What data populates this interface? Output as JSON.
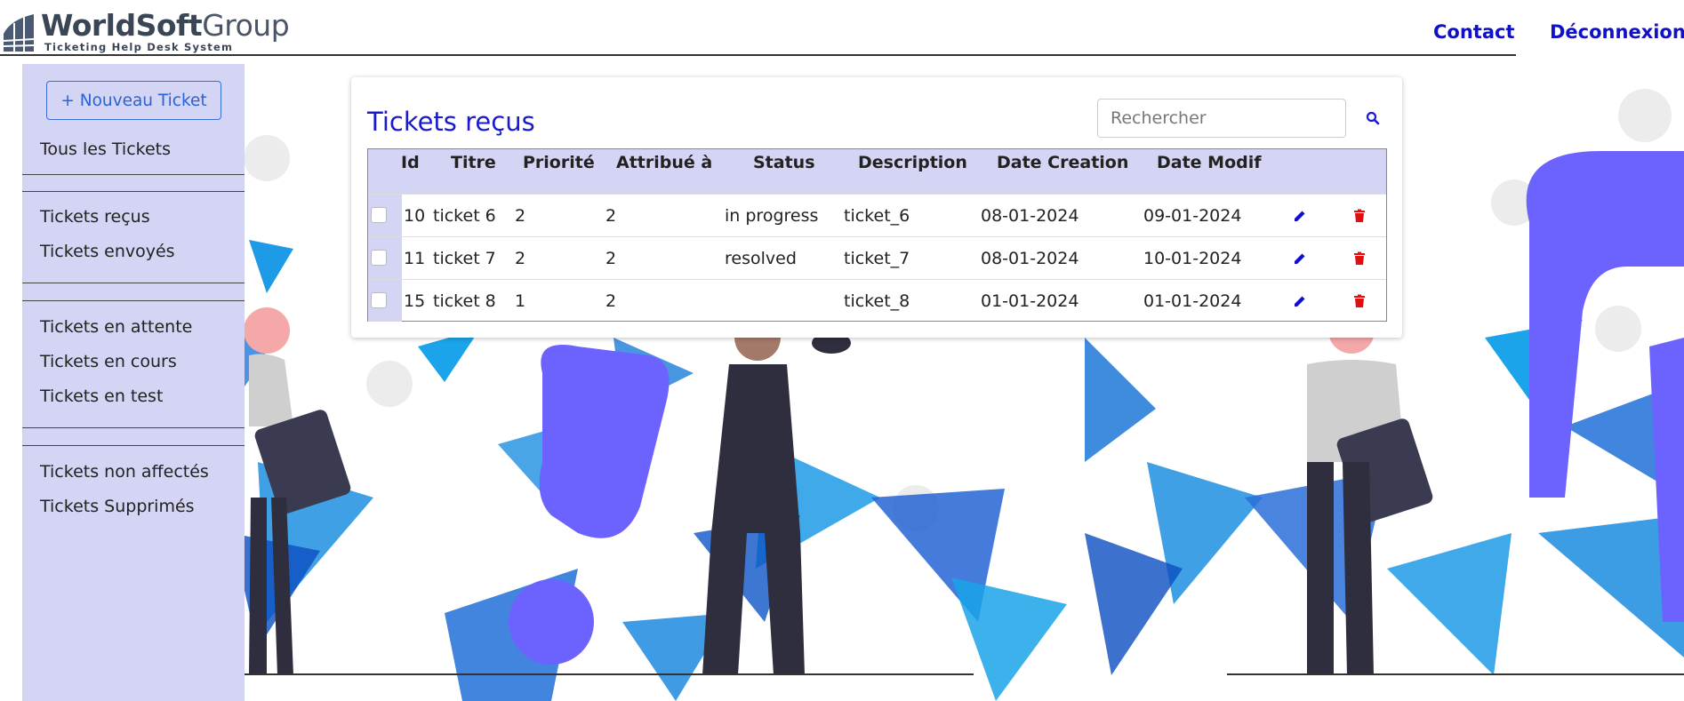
{
  "header": {
    "logo_brand_bold": "WorldSoft",
    "logo_brand_light": "Group",
    "logo_tagline": "Ticketing Help Desk System",
    "nav": {
      "contact_label": "Contact",
      "logout_label": "Déconnexion"
    }
  },
  "sidebar": {
    "new_ticket_label": "+ Nouveau Ticket",
    "items": [
      {
        "label": "Tous les Tickets"
      },
      {
        "label": "Tickets reçus"
      },
      {
        "label": "Tickets envoyés"
      },
      {
        "label": "Tickets en attente"
      },
      {
        "label": "Tickets en cours"
      },
      {
        "label": "Tickets en test"
      },
      {
        "label": "Tickets non affectés"
      },
      {
        "label": "Tickets Supprimés"
      }
    ]
  },
  "main": {
    "title": "Tickets reçus",
    "search": {
      "placeholder": "Rechercher"
    },
    "table": {
      "columns": [
        "Id",
        "Titre",
        "Priorité",
        "Attribué à",
        "Status",
        "Description",
        "Date Creation",
        "Date Modif"
      ],
      "rows": [
        {
          "id": "10",
          "titre": "ticket 6",
          "priorite": "2",
          "attribue": "2",
          "status": "in progress",
          "description": "ticket_6",
          "date_creation": "08-01-2024",
          "date_modif": "09-01-2024"
        },
        {
          "id": "11",
          "titre": "ticket 7",
          "priorite": "2",
          "attribue": "2",
          "status": "resolved",
          "description": "ticket_7",
          "date_creation": "08-01-2024",
          "date_modif": "10-01-2024"
        },
        {
          "id": "15",
          "titre": "ticket 8",
          "priorite": "1",
          "attribue": "2",
          "status": "",
          "description": "ticket_8",
          "date_creation": "01-01-2024",
          "date_modif": "01-01-2024"
        }
      ]
    }
  },
  "icons": {
    "edit": "pencil-icon",
    "delete": "trash-icon",
    "search": "search-icon"
  },
  "colors": {
    "accent": "#1010c8",
    "sidebar_bg": "#d4d4f5",
    "delete_red": "#e01010",
    "button_blue": "#2a63d3"
  }
}
